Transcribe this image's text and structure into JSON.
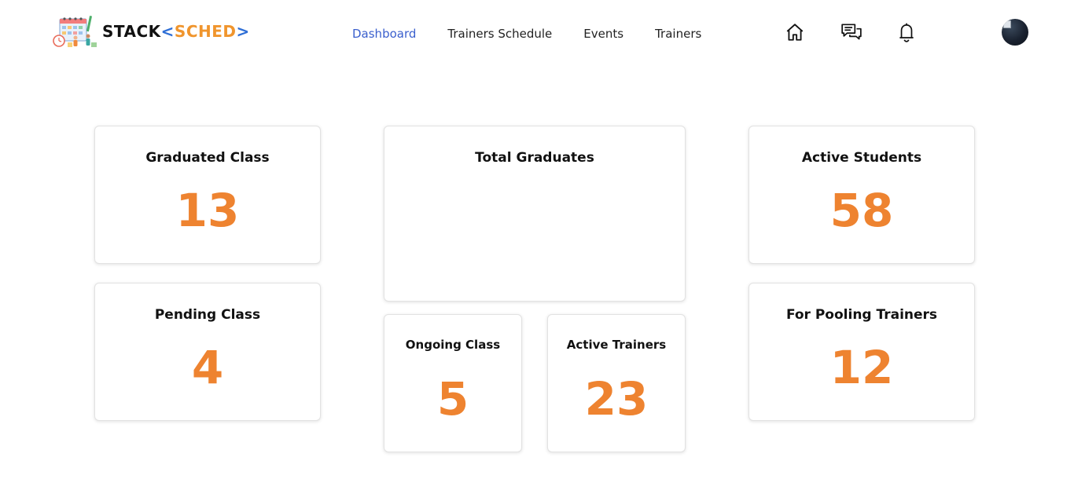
{
  "brand": {
    "stack": "STACK",
    "open_bracket": "<",
    "sched": "SCHED",
    "close_bracket": ">",
    "colors": {
      "stack": "#111111",
      "bracket": "#2f6fd6",
      "sched": "#f0952d"
    }
  },
  "nav": {
    "items": [
      {
        "label": "Dashboard",
        "active": true
      },
      {
        "label": "Trainers Schedule",
        "active": false
      },
      {
        "label": "Events",
        "active": false
      },
      {
        "label": "Trainers",
        "active": false
      }
    ],
    "active_color": "#3a5fcd"
  },
  "header_icons": [
    "home-icon",
    "chat-icon",
    "bell-icon"
  ],
  "cards": {
    "graduated_class": {
      "title": "Graduated Class",
      "value": "13"
    },
    "pending_class": {
      "title": "Pending Class",
      "value": "4"
    },
    "total_graduates": {
      "title": "Total Graduates",
      "value": ""
    },
    "ongoing_class": {
      "title": "Ongoing Class",
      "value": "5"
    },
    "active_trainers": {
      "title": "Active Trainers",
      "value": "23"
    },
    "active_students": {
      "title": "Active Students",
      "value": "58"
    },
    "for_pooling_trainers": {
      "title": "For Pooling Trainers",
      "value": "12"
    }
  },
  "accent_color": "#ee8330"
}
